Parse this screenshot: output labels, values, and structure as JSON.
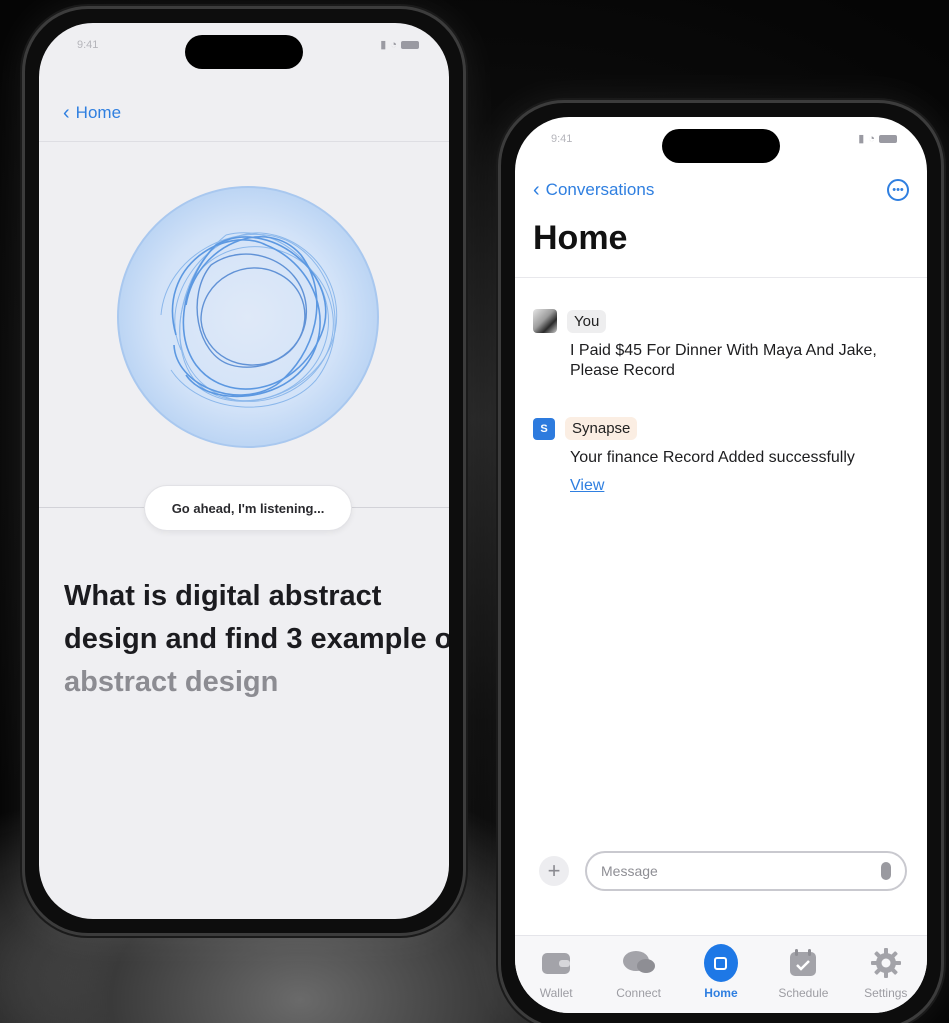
{
  "phone_left": {
    "status_time": "9:41",
    "back_label": "Home",
    "listening_text": "Go ahead, I'm listening...",
    "query_main": "What is digital abstract design and find 3 example of ",
    "query_dim": "abstract design"
  },
  "phone_right": {
    "status_time": "9:41",
    "back_label": "Conversations",
    "more_icon": "ellipsis-circle-icon",
    "title": "Home",
    "messages": [
      {
        "sender": "You",
        "text": "I Paid $45 For Dinner With Maya And Jake, Please Record"
      },
      {
        "sender": "Synapse",
        "avatar_letter": "S",
        "text": "Your finance Record Added successfully",
        "link": "View"
      }
    ],
    "composer": {
      "placeholder": "Message",
      "plus_icon": "plus-icon",
      "mic_icon": "mic-icon"
    },
    "tabs": [
      {
        "label": "Wallet",
        "icon": "wallet-icon"
      },
      {
        "label": "Connect",
        "icon": "chat-bubbles-icon"
      },
      {
        "label": "Home",
        "icon": "home-icon",
        "active": true
      },
      {
        "label": "Schedule",
        "icon": "calendar-icon"
      },
      {
        "label": "Settings",
        "icon": "gear-icon"
      }
    ]
  },
  "colors": {
    "accent": "#2f7fe0",
    "active_tab": "#1e78e6",
    "background": "#0b0b0b"
  }
}
